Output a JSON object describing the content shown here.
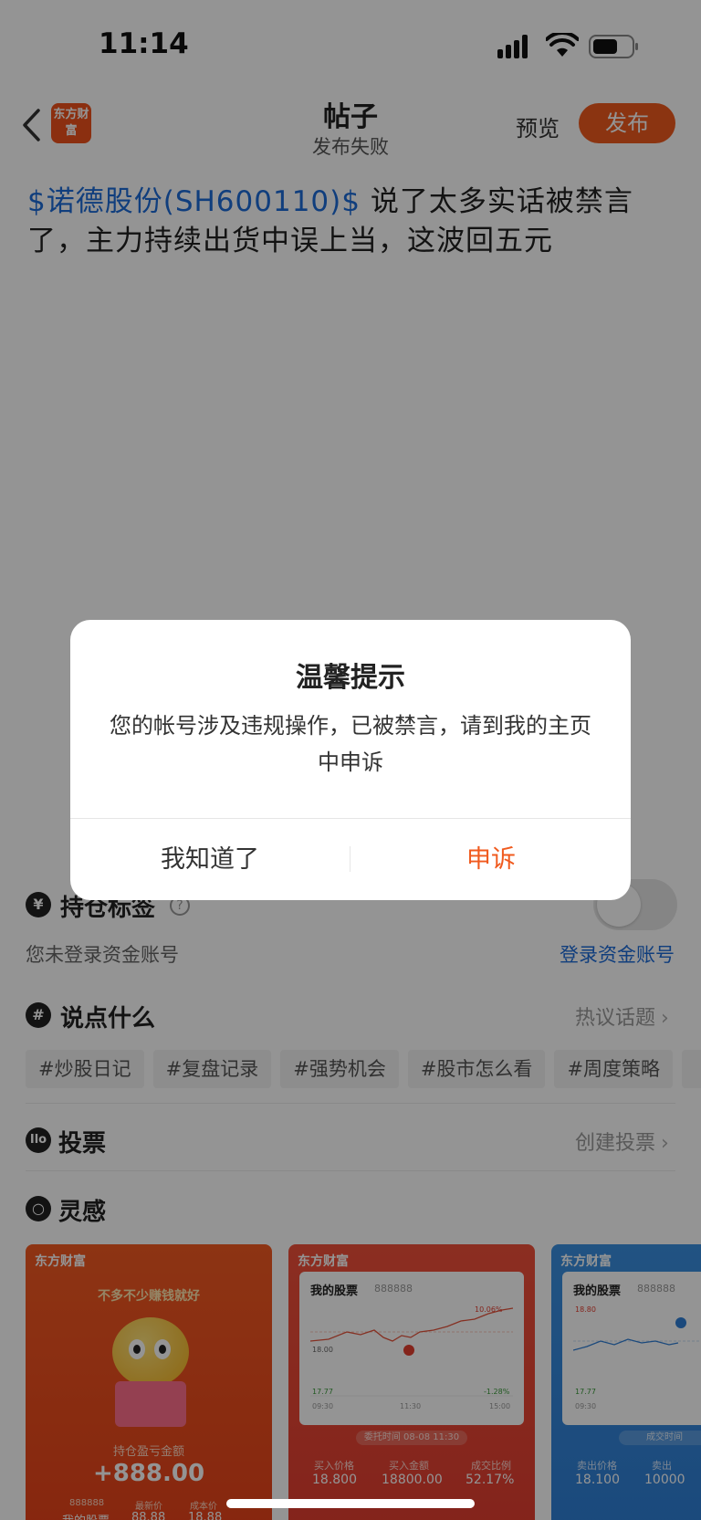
{
  "status_bar": {
    "time": "11:14"
  },
  "nav": {
    "logo_text": "东方财富",
    "title": "帖子",
    "subtitle": "发布失败",
    "preview_label": "预览",
    "publish_label": "发布"
  },
  "post": {
    "stock_tag": "$诺德股份(SH600110)$",
    "text": " 说了太多实话被禁言了，主力持续出货中误上当，这波回五元"
  },
  "holdings": {
    "icon": "yen-icon",
    "title": "持仓标签",
    "not_logged": "您未登录资金账号",
    "login_link": "登录资金账号"
  },
  "say_something": {
    "title": "说点什么",
    "hot_topics": "热议话题",
    "chips": [
      "#炒股日记",
      "#复盘记录",
      "#强势机会",
      "#股市怎么看",
      "#周度策略"
    ]
  },
  "vote": {
    "title": "投票",
    "create_link": "创建投票"
  },
  "inspiration": {
    "title": "灵感",
    "card1": {
      "brand": "东方财富",
      "slogan": "不多不少赚钱就好",
      "amount_label": "持仓盈亏金额",
      "amount": "+888.00",
      "code": "888888",
      "name": "我的股票",
      "latest_label": "最新价",
      "latest": "88.88",
      "cost_label": "成本价",
      "cost": "18.88"
    },
    "card2": {
      "brand": "东方财富",
      "panel_title": "我的股票",
      "panel_code": "888888",
      "top_pct": "10.06%",
      "mid_price": "18.00",
      "low_price": "17.77",
      "low_pct": "-1.28%",
      "t1": "09:30",
      "t2": "11:30",
      "t3": "15:00",
      "order_time": "委托时间 08-08 11:30",
      "buy_price_label": "买入价格",
      "buy_price": "18.800",
      "buy_amount_label": "买入金额",
      "buy_amount": "18800.00",
      "ratio_label": "成交比例",
      "ratio": "52.17%"
    },
    "card3": {
      "brand": "东方财富",
      "panel_title": "我的股票",
      "panel_code": "888888",
      "high": "18.80",
      "low": "17.77",
      "t1": "09:30",
      "trade_time": "成交时间",
      "sell_price_label": "卖出价格",
      "sell_price": "18.100",
      "sell_amount_label": "卖出",
      "sell_amount": "10000"
    }
  },
  "dialog": {
    "title": "温馨提示",
    "message": "您的帐号涉及违规操作，已被禁言，请到我的主页中申诉",
    "ok_label": "我知道了",
    "appeal_label": "申诉"
  }
}
